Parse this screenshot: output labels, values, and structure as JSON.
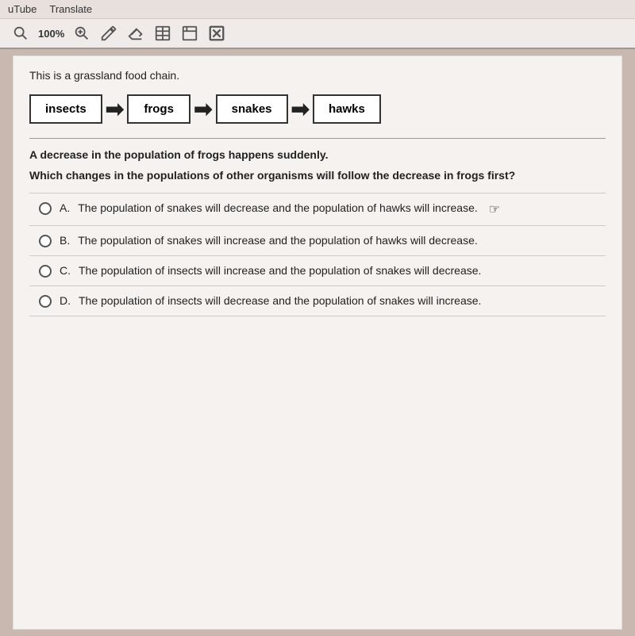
{
  "browser": {
    "tabs": [
      "uTube",
      "Translate"
    ]
  },
  "toolbar": {
    "zoom": "100%",
    "icons": [
      "search",
      "zoom-in",
      "pencil",
      "eraser",
      "book",
      "note",
      "close"
    ]
  },
  "content": {
    "intro": "This is a grassland food chain.",
    "food_chain": {
      "items": [
        "insects",
        "frogs",
        "snakes",
        "hawks"
      ]
    },
    "description": "A decrease in the population of frogs happens suddenly.",
    "question": "Which changes in the populations of other organisms will follow the decrease in frogs first?",
    "options": [
      {
        "letter": "A.",
        "text": "The population of snakes will decrease and the population of hawks will increase."
      },
      {
        "letter": "B.",
        "text": "The population of snakes will increase and the population of hawks will decrease."
      },
      {
        "letter": "C.",
        "text": "The population of insects will increase and the population of snakes will decrease."
      },
      {
        "letter": "D.",
        "text": "The population of insects will decrease and the population of snakes will increase."
      }
    ]
  }
}
